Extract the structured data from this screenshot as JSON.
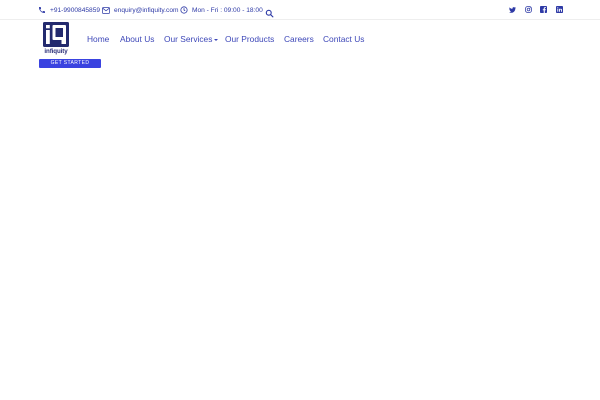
{
  "topbar": {
    "phone": {
      "icon": "phone-icon",
      "text": "+91-9900845859"
    },
    "email": {
      "icon": "envelope-icon",
      "text": "enquiry@infiquity.com"
    },
    "hours": {
      "icon": "clock-icon",
      "text": "Mon - Fri : 09:00 - 18:00"
    },
    "search": {
      "icon": "search-icon"
    },
    "social": [
      {
        "name": "twitter",
        "icon": "twitter-icon"
      },
      {
        "name": "instagram",
        "icon": "instagram-icon"
      },
      {
        "name": "facebook",
        "icon": "facebook-icon"
      },
      {
        "name": "linkedin",
        "icon": "linkedin-icon"
      }
    ]
  },
  "brand": {
    "logo_mark": "iq",
    "name": "infiquity"
  },
  "cta": {
    "label": "GET STARTED"
  },
  "nav": {
    "items": [
      {
        "label": "Home"
      },
      {
        "label": "About Us"
      },
      {
        "label": "Our Services",
        "has_dropdown": true
      },
      {
        "label": "Our Products"
      },
      {
        "label": "Careers"
      },
      {
        "label": "Contact Us"
      }
    ]
  },
  "colors": {
    "primary": "#2e3aa6",
    "button": "#3a43e0",
    "nav_text": "#3d47b8",
    "background": "#ffffff"
  }
}
